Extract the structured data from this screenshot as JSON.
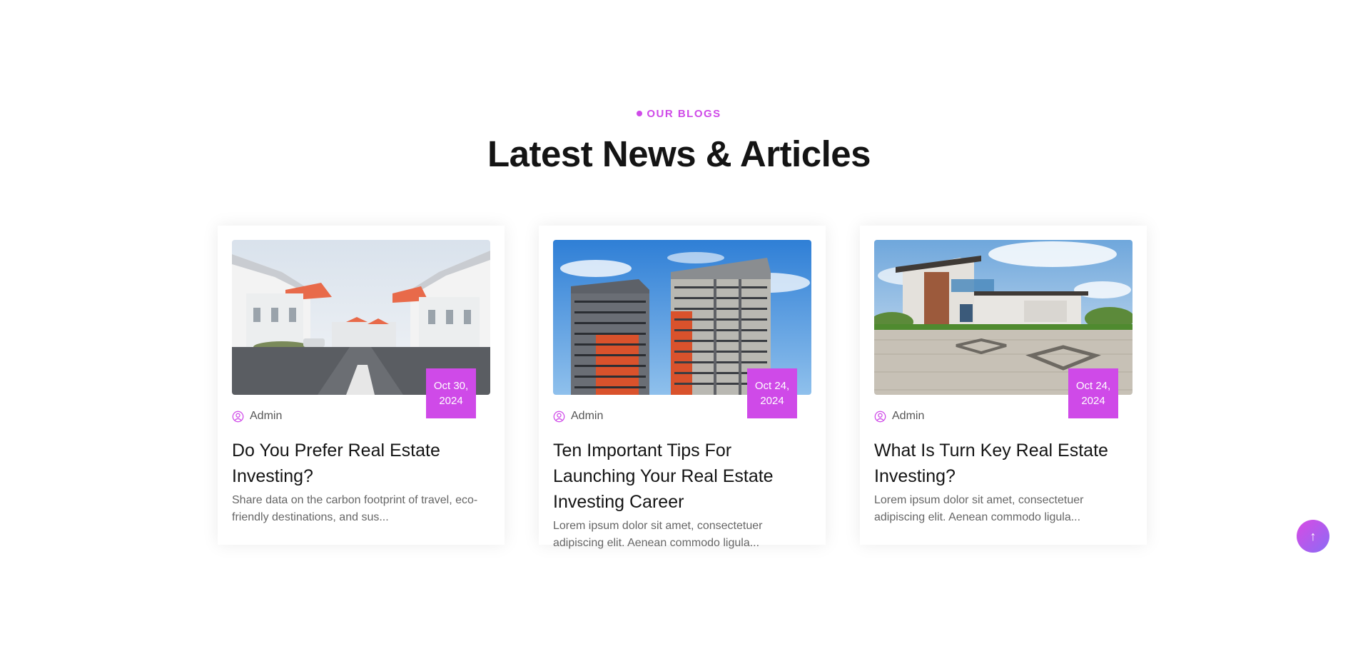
{
  "section": {
    "eyebrow": "OUR BLOGS",
    "heading": "Latest News & Articles"
  },
  "accent_color": "#cf4ae8",
  "posts": [
    {
      "image": "white-suburban-houses-street",
      "date": "Oct 30, 2024",
      "author": "Admin",
      "title": "Do You Prefer Real Estate Investing?",
      "excerpt": "Share data on the carbon footprint of travel, eco-friendly destinations, and sus..."
    },
    {
      "image": "apartment-towers-blue-sky",
      "date": "Oct 24, 2024",
      "author": "Admin",
      "title": "Ten Important Tips For Launching Your Real Estate Investing Career",
      "excerpt": "Lorem ipsum dolor sit amet, consectetuer adipiscing elit. Aenean commodo ligula..."
    },
    {
      "image": "modern-villa-paved-driveway",
      "date": "Oct 24, 2024",
      "author": "Admin",
      "title": "What Is Turn Key Real Estate Investing?",
      "excerpt": "Lorem ipsum dolor sit amet, consectetuer adipiscing elit. Aenean commodo ligula..."
    }
  ],
  "scroll_top": {
    "icon": "arrow-up-icon",
    "glyph": "↑"
  }
}
